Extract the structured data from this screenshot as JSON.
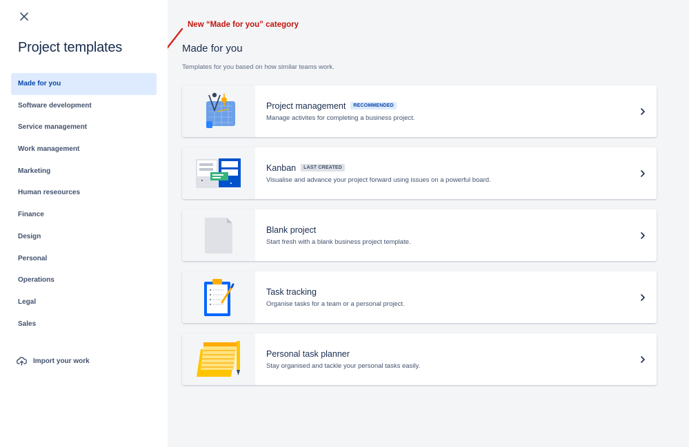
{
  "sidebar": {
    "title": "Project templates",
    "categories": [
      {
        "label": "Made for you",
        "active": true
      },
      {
        "label": "Software development"
      },
      {
        "label": "Service management"
      },
      {
        "label": "Work management"
      },
      {
        "label": "Marketing"
      },
      {
        "label": "Human reseources"
      },
      {
        "label": "Finance"
      },
      {
        "label": "Design"
      },
      {
        "label": "Personal"
      },
      {
        "label": "Operations"
      },
      {
        "label": "Legal"
      },
      {
        "label": "Sales"
      }
    ],
    "import_label": "Import your work"
  },
  "annotation": {
    "text": "New “Made for you” category",
    "color": "#c0150e"
  },
  "main": {
    "heading": "Made for you",
    "subheading": "Templates for you based on how similar teams work.",
    "templates": [
      {
        "title": "Project management",
        "badge": "RECOMMENDED",
        "description": "Manage activites for completing a business project.",
        "icon": "project-management-illustration"
      },
      {
        "title": "Kanban",
        "badge": "LAST CREATED",
        "description": "Visualise and advance your project forward using issues on a powerful board.",
        "icon": "kanban-illustration"
      },
      {
        "title": "Blank project",
        "badge": "",
        "description": "Start fresh with a blank business project template.",
        "icon": "blank-page-illustration"
      },
      {
        "title": "Task tracking",
        "badge": "",
        "description": "Organise tasks for a team or a personal project.",
        "icon": "clipboard-illustration"
      },
      {
        "title": "Personal task planner",
        "badge": "",
        "description": "Stay organised and tackle your personal tasks easily.",
        "icon": "notepad-illustration"
      }
    ]
  },
  "colors": {
    "active_bg": "#deebff",
    "active_text": "#0747a6",
    "brand_blue": "#0052cc"
  }
}
